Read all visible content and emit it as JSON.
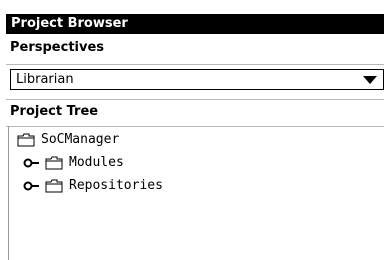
{
  "panel": {
    "title": "Project Browser"
  },
  "perspectives": {
    "label": "Perspectives",
    "selected": "Librarian"
  },
  "project_tree": {
    "label": "Project Tree",
    "root": {
      "label": "SoCManager",
      "icon": "folder-icon"
    },
    "children": [
      {
        "label": "Modules",
        "icon": "folder-icon",
        "expander": "expander-icon"
      },
      {
        "label": "Repositories",
        "icon": "folder-icon",
        "expander": "expander-icon"
      }
    ]
  },
  "colors": {
    "title_bg": "#000000",
    "title_fg": "#ffffff",
    "divider": "#b8b8b8",
    "text": "#000000"
  }
}
